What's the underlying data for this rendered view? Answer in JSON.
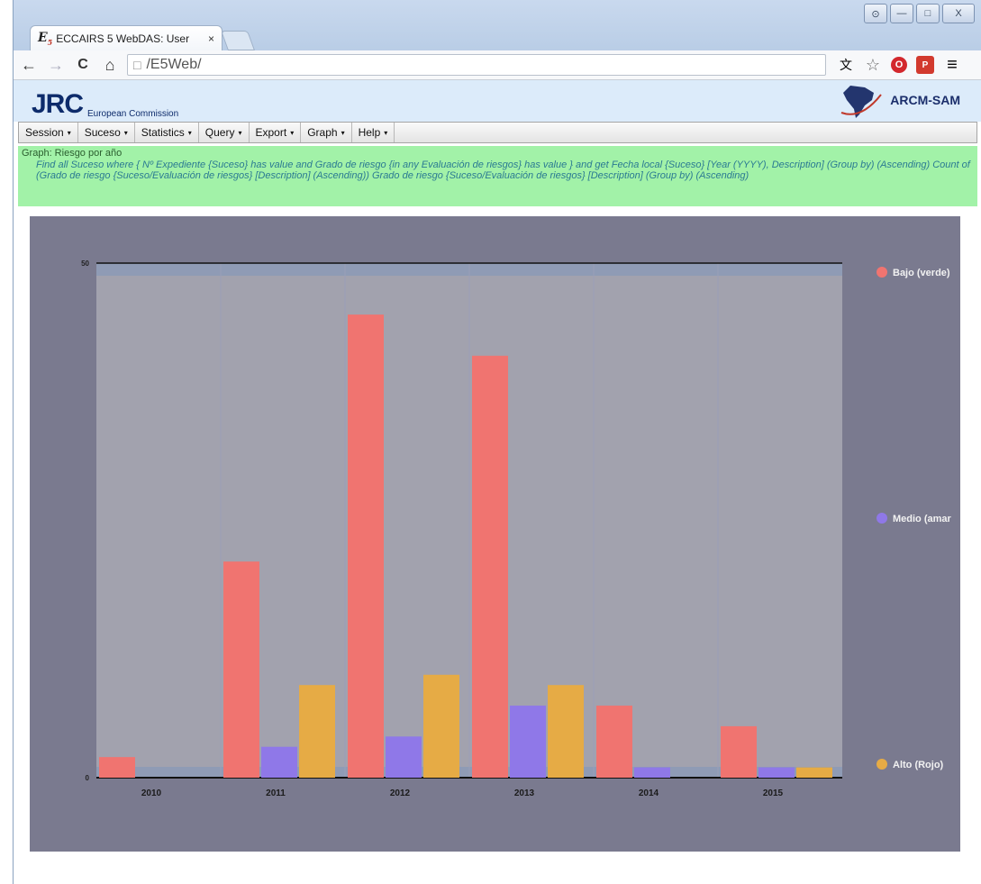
{
  "browser": {
    "tab_logo": "E",
    "tab_logo_sub": "5",
    "tab_title": "ECCAIRS 5 WebDAS: User",
    "tab_close": "×",
    "url": "/E5Web/",
    "nav": {
      "back": "←",
      "forward": "→",
      "reload": "C",
      "home": "⌂",
      "page_icon": "□"
    },
    "window_controls": {
      "minimize": "—",
      "maximize": "□",
      "close": "X",
      "user": "⊙"
    },
    "extensions": {
      "translate": "文",
      "star": "☆",
      "opera": "O",
      "pdf": "P",
      "menu": "≡"
    }
  },
  "header": {
    "brand": "JRC",
    "brand_sub": "European Commission",
    "partner": "ARCM-SAM"
  },
  "menu": [
    {
      "label": "Session",
      "caret": "▾"
    },
    {
      "label": "Suceso",
      "caret": "▾"
    },
    {
      "label": "Statistics",
      "caret": "▾"
    },
    {
      "label": "Query",
      "caret": "▾"
    },
    {
      "label": "Export",
      "caret": "▾"
    },
    {
      "label": "Graph",
      "caret": "▾"
    },
    {
      "label": "Help",
      "caret": "▾"
    }
  ],
  "info": {
    "title": "Graph: Riesgo por año",
    "query": "Find all Suceso where { Nº Expediente {Suceso} has value and Grado de riesgo {in any Evaluación de riesgos} has value } and get Fecha local {Suceso} [Year (YYYY), Description] (Group by) (Ascending) Count of (Grado de riesgo {Suceso/Evaluación de riesgos} [Description] (Ascending)) Grado de riesgo {Suceso/Evaluación de riesgos} [Description] (Group by) (Ascending)"
  },
  "colors": {
    "bajo": "#f07470",
    "medio": "#8f78e8",
    "alto": "#e6ab45",
    "plot_bg": "#a2a2ae",
    "chart_bg": "#7a7a8f"
  },
  "chart_data": {
    "type": "bar",
    "categories": [
      "2010",
      "2011",
      "2012",
      "2013",
      "2014",
      "2015"
    ],
    "series": [
      {
        "name": "Bajo (verde)",
        "values": [
          2,
          21,
          45,
          41,
          7,
          5
        ]
      },
      {
        "name": "Medio (amar",
        "values": [
          0,
          3,
          4,
          7,
          1,
          1
        ]
      },
      {
        "name": "Alto (Rojo)",
        "values": [
          0,
          9,
          10,
          9,
          0,
          1
        ]
      }
    ],
    "yticks": [
      "0",
      "50"
    ],
    "ylim": [
      0,
      50
    ],
    "grid": true,
    "legend_position": "right"
  }
}
